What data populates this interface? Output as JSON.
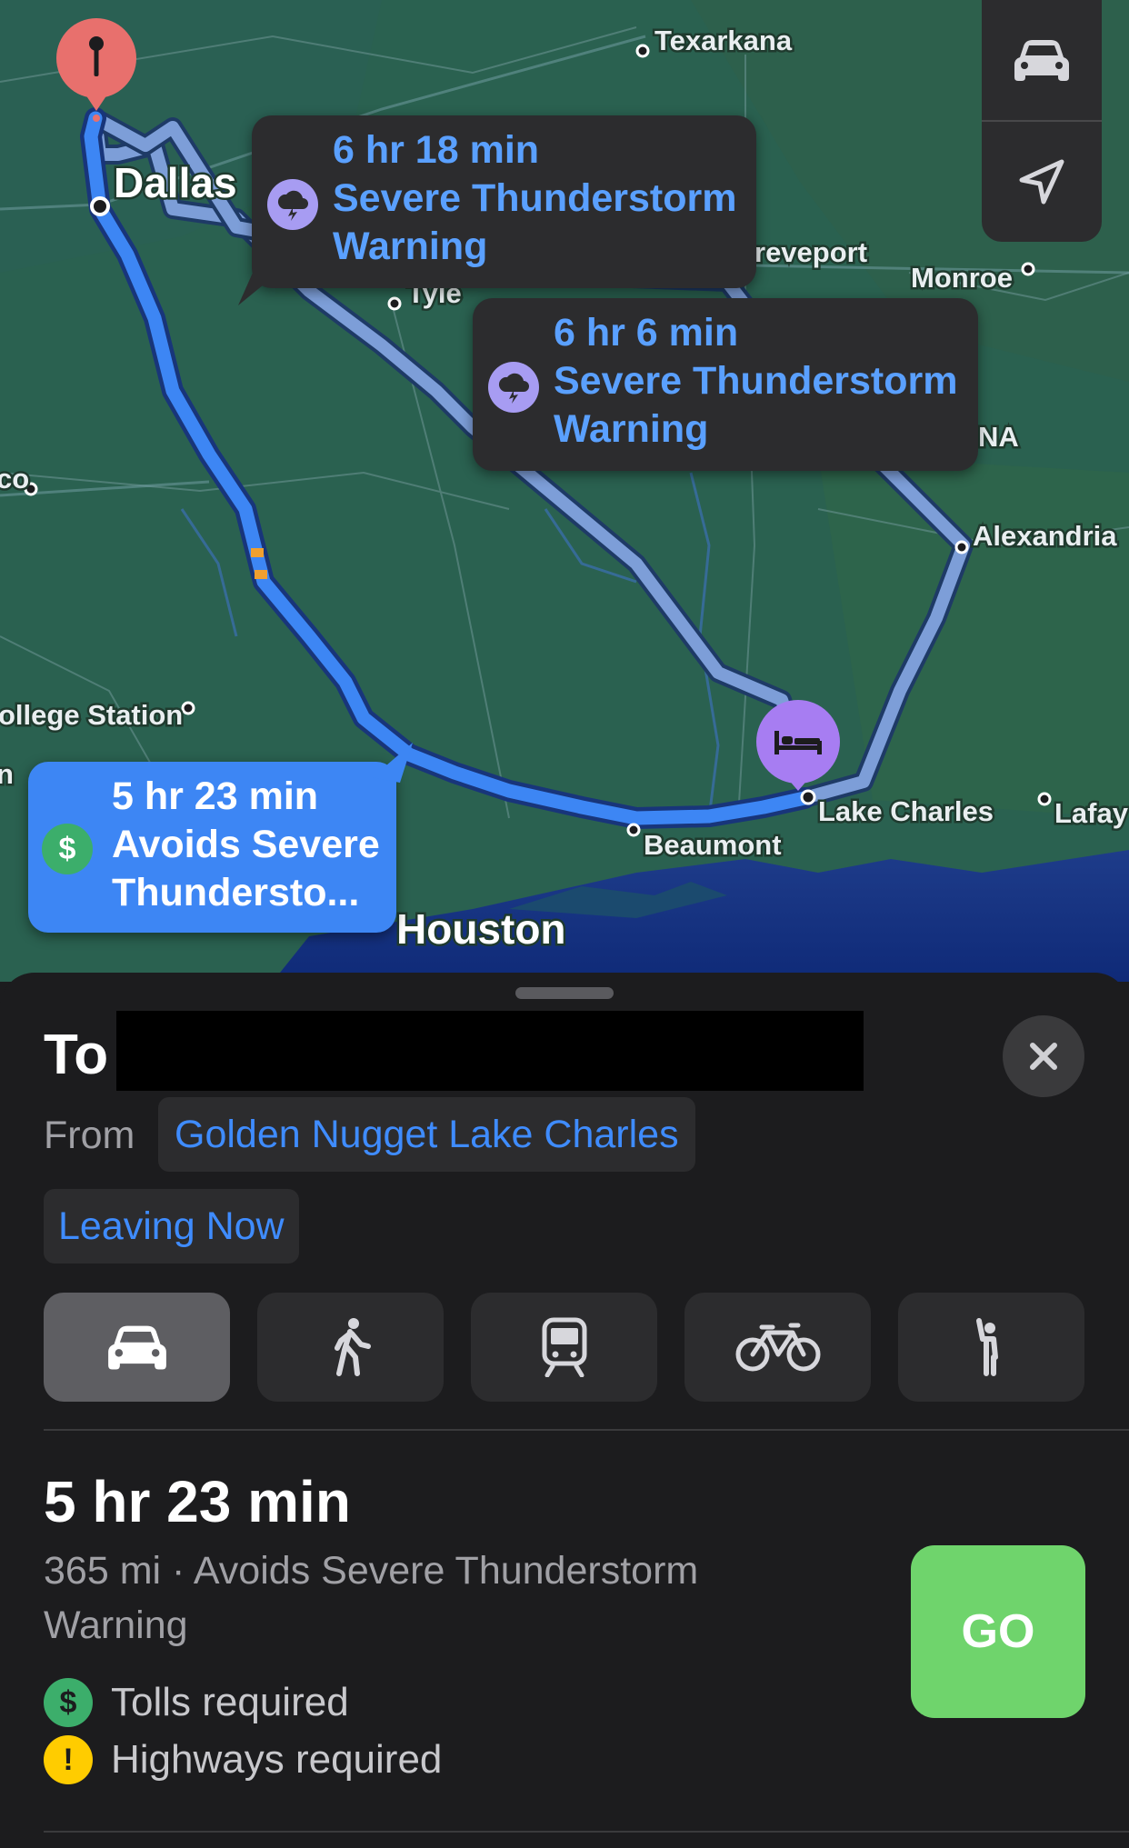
{
  "map": {
    "labels": {
      "texarkana": "Texarkana",
      "dallas": "Dallas",
      "shreveport": "reveport",
      "tyler": "Tyle",
      "monroe": "Monroe",
      "na": "NA",
      "alexandria": "Alexandria",
      "college_station": "ollege Station",
      "lake_charles": "Lake Charles",
      "lafayette": "Lafay",
      "beaumont": "Beaumont",
      "houston": "Houston",
      "left_co": "co",
      "left_n": "n"
    },
    "callouts": [
      {
        "time": "6 hr 18 min",
        "line1": "Severe Thunderstorm",
        "line2": "Warning"
      },
      {
        "time": "6 hr 6 min",
        "line1": "Severe Thunderstorm",
        "line2": "Warning"
      },
      {
        "time": "5 hr 23 min",
        "line1": "Avoids Severe",
        "line2": "Thundersto...",
        "badge": "$"
      }
    ],
    "controls": {
      "car": "car-icon",
      "location": "location-arrow-icon"
    }
  },
  "sheet": {
    "to_label": "To",
    "from_label": "From",
    "from_value": "Golden Nugget Lake Charles",
    "leaving": "Leaving Now",
    "modes": [
      "car",
      "walk",
      "transit",
      "bike",
      "rideshare"
    ],
    "selected_mode": "car",
    "route": {
      "time": "5 hr 23 min",
      "detail": "365 mi · Avoids Severe Thunderstorm Warning",
      "tolls": "Tolls required",
      "tolls_badge": "$",
      "highways": "Highways required",
      "highways_badge": "!"
    },
    "go": "GO"
  },
  "colors": {
    "accent": "#3f8cff",
    "route_selected": "#3d86f4",
    "route_alt": "#7d9ed8",
    "go": "#6fd46c",
    "weather": "#a79cf2",
    "toll": "#3cae6b",
    "warning": "#ffcc00"
  }
}
